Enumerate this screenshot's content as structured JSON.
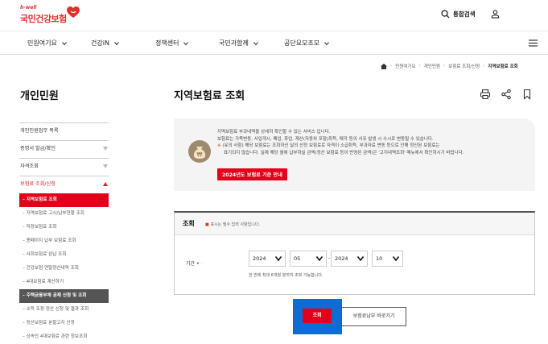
{
  "header": {
    "logo_top": "h-well",
    "logo_main": "국민건강보험",
    "search_label": "통합검색"
  },
  "gnb": [
    {
      "label": "민원여기요"
    },
    {
      "label": "건강iN"
    },
    {
      "label": "정책센터"
    },
    {
      "label": "국민과함께"
    },
    {
      "label": "공단요모조모"
    }
  ],
  "breadcrumb": [
    "민원여기요",
    "개인민원",
    "보험료 조회/신청",
    "지역보험료 조회"
  ],
  "sidebar": {
    "title": "개인민원",
    "items": [
      {
        "label": "개인민원업무 목록",
        "caret": false
      },
      {
        "label": "증명서 발급/확인",
        "caret": true
      },
      {
        "label": "자격조회",
        "caret": true
      },
      {
        "label": "보험료 조회/신청",
        "caret": true
      }
    ],
    "subitems": [
      "지역보험료 조회",
      "지역보험료 고시/납부현황 조회",
      "직장보험료 조회",
      "종페이지 납부 보험료 조회",
      "사회보험료 완납 조회",
      "건강보험 연말정산내역 조회",
      "4대보험료 계산하기",
      "주택금융부채 공제 신청 및 조회",
      "소득 조정·정산 신청 및 결과 조회",
      "징산보험료 분할고지 신청",
      "상속인 4대보험료 관련 정보조회"
    ]
  },
  "main": {
    "title": "지역보험료 조회",
    "info": {
      "line1": "지역보험료 부과내역을 상세히 확인할 수 있는 서비스 입니다.",
      "line2": "보험료는 가족변동, 사업개시, 폐업, 휴업, 재산(자동차 포함)취득, 매각 등의 사유 발생 시 수시로 변동될 수 있습니다.",
      "line3": "(유의 사항) 해당 보험료는 조회하신 달의 산정 보험료로 자격이 소급취득, 부과자료 변동 등으로 인해 정산된 보험료는",
      "line4": "표기되지 않습니다. 실제 해당 월에 납부하실 금액(정산 보험료 등이 반영된 금액)은 '고지내역조회' 메뉴에서 확인하시기 바랍니다.",
      "button": "2024년도 보험료 기준 안내"
    },
    "form": {
      "title": "조회",
      "note_prefix": "표시는 필수 입력 사항입니다.",
      "period_label": "기간",
      "from_year": "2024",
      "from_month": "05",
      "to_year": "2024",
      "to_month": "10",
      "hint": "한 번에 최대 6개월 분까지 조회 가능합니다."
    },
    "query_button": "조회",
    "ghost_button": "보험료납부 바로가기"
  }
}
